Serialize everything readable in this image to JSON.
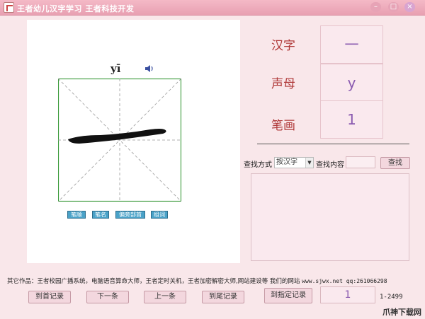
{
  "window": {
    "title": "王者幼儿汉字学习 王者科技开发",
    "min": "–",
    "max": "□",
    "close": "×"
  },
  "display": {
    "pinyin": "yī",
    "glyph": "一"
  },
  "stroke_buttons": [
    "笔顺",
    "笔名",
    "偏旁部首",
    "组词"
  ],
  "info": {
    "hanzi_label": "汉字",
    "hanzi_value": "一",
    "shengmu_label": "声母",
    "shengmu_value": "y",
    "bihua_label": "笔画",
    "bihua_value": "1"
  },
  "search": {
    "method_label": "查找方式",
    "method_value": "按汉字",
    "content_label": "查找内容",
    "content_value": "",
    "button": "查找"
  },
  "footer": {
    "prefix": "其它作品：王者校园广播系统，电脑语音算命大师，王者定时关机，王者加密解密大师,网站建设等 我们的网站",
    "url": "www.sjwx.net qq:261066298"
  },
  "nav": {
    "first": "到首记录",
    "next": "下一条",
    "prev": "上一条",
    "last": "到尾记录",
    "goto": "到指定记录",
    "goto_value": "1",
    "range": "1-2499"
  },
  "watermark": "爪神下载网"
}
